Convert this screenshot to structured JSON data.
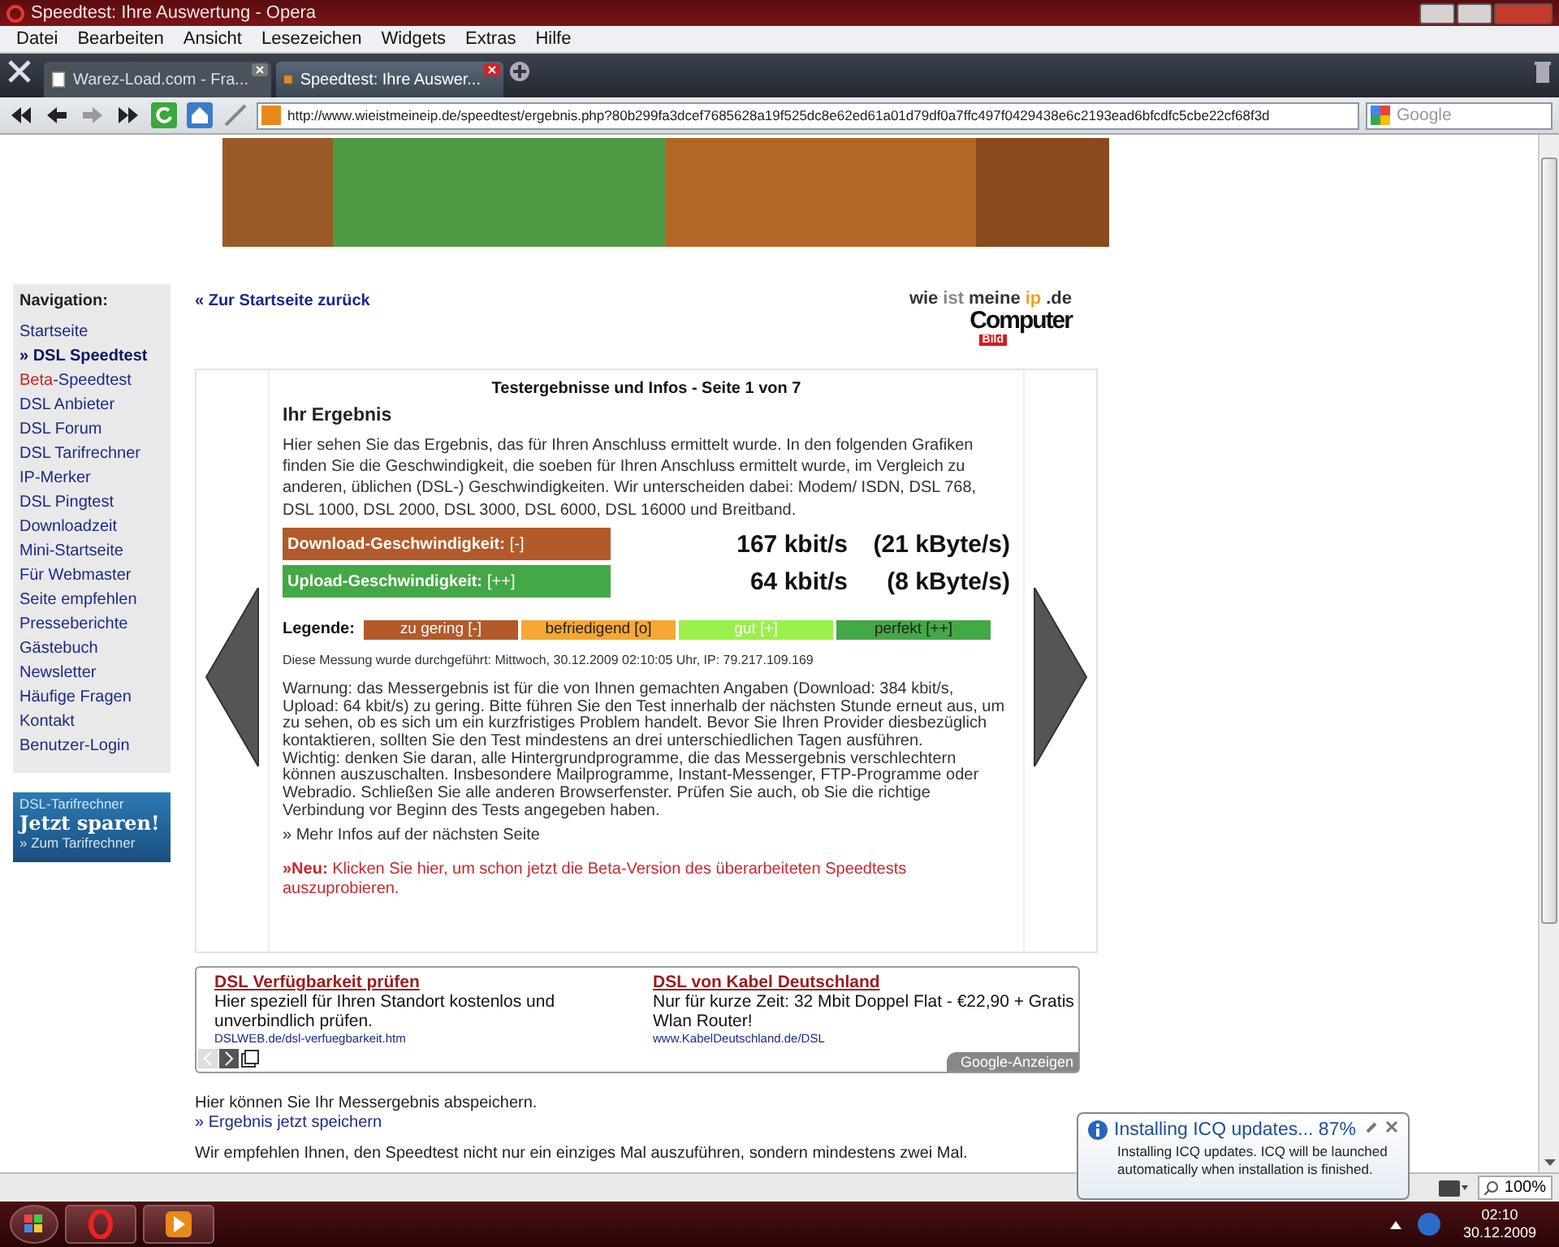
{
  "window": {
    "title": "Speedtest: Ihre Auswertung - Opera"
  },
  "menu": [
    "Datei",
    "Bearbeiten",
    "Ansicht",
    "Lesezeichen",
    "Widgets",
    "Extras",
    "Hilfe"
  ],
  "tabs": [
    {
      "label": "Warez-Load.com - Fra...",
      "selected": false
    },
    {
      "label": "Speedtest: Ihre Auswer...",
      "selected": true
    }
  ],
  "address_bar": {
    "url": "http://www.wieistmeineip.de/speedtest/ergebnis.php?80b299fa3dcef7685628a19f525dc8e62ed61a01d79df0a7ffc497f0429438e6c2193ead6bfcdfc5cbe22cf68f3d",
    "search_placeholder": "Google"
  },
  "sidebar": {
    "title": "Navigation:",
    "items": [
      {
        "label": "Startseite",
        "selected": false
      },
      {
        "label": "» DSL Speedtest",
        "selected": true
      },
      {
        "prefix": "Beta",
        "label": "-Speedtest",
        "selected": false
      },
      {
        "label": "DSL Anbieter",
        "selected": false
      },
      {
        "label": "DSL Forum",
        "selected": false
      },
      {
        "label": "DSL Tarifrechner",
        "selected": false
      },
      {
        "label": "IP-Merker",
        "selected": false
      },
      {
        "label": "DSL Pingtest",
        "selected": false
      },
      {
        "label": "Downloadzeit",
        "selected": false
      },
      {
        "label": "Mini-Startseite",
        "selected": false
      },
      {
        "label": "Für Webmaster",
        "selected": false
      },
      {
        "label": "Seite empfehlen",
        "selected": false
      },
      {
        "label": "Presseberichte",
        "selected": false
      },
      {
        "label": "Gästebuch",
        "selected": false
      },
      {
        "label": "Newsletter",
        "selected": false
      },
      {
        "label": "Häufige Fragen",
        "selected": false
      },
      {
        "label": "Kontakt",
        "selected": false
      },
      {
        "label": "Benutzer-Login",
        "selected": false
      }
    ],
    "promo": {
      "title": "DSL-Tarifrechner",
      "headline": "Jetzt sparen!",
      "link": "» Zum Tarifrechner"
    }
  },
  "back_link": "« Zur Startseite zurück",
  "logo": {
    "words": [
      {
        "text": "wie",
        "color": "#333333"
      },
      {
        "text": "ist",
        "color": "#888888"
      },
      {
        "text": "meine",
        "color": "#333333"
      },
      {
        "text": "ip",
        "color": "#f0a020"
      },
      {
        "text": ".de",
        "color": "#333333"
      }
    ],
    "brand": "Computer",
    "badge": "Bild"
  },
  "results": {
    "title": "Testergebnisse und Infos - Seite 1 von 7",
    "heading": "Ihr Ergebnis",
    "intro": "Hier sehen Sie das Ergebnis, das für Ihren Anschluss ermittelt wurde. In den folgenden Grafiken finden Sie die Geschwindigkeit, die soeben für Ihren Anschluss ermittelt wurde, im Vergleich zu anderen, üblichen (DSL-) Geschwindigkeiten. Wir unterscheiden dabei: Modem/ ISDN, DSL 768, DSL 1000, DSL 2000, DSL 3000, DSL 6000, DSL 16000 und Breitband.",
    "speeds": [
      {
        "label": "Download-Geschwindigkeit:",
        "rating": "[-]",
        "color": "#b25a2a",
        "kbit": "167 kbit/s",
        "kbyte": "(21 kByte/s)"
      },
      {
        "label": "Upload-Geschwindigkeit:",
        "rating": "[++]",
        "color": "#43a845",
        "kbit": "64 kbit/s",
        "kbyte": "(8 kByte/s)"
      }
    ],
    "legend": {
      "label": "Legende:",
      "items": [
        {
          "label": "zu gering [-]",
          "color": "#b25a2a"
        },
        {
          "label": "befriedigend [o]",
          "color": "#f5a833"
        },
        {
          "label": "gut [+]",
          "color": "#9af04a"
        },
        {
          "label": "perfekt [++]",
          "color": "#43a845"
        }
      ]
    },
    "measured": "Diese Messung wurde durchgeführt: Mittwoch, 30.12.2009 02:10:05 Uhr, IP: 79.217.109.169",
    "warnings": [
      "Warnung: das Messergebnis ist für die von Ihnen gemachten Angaben (Download: 384 kbit/s, Upload: 64 kbit/s) zu gering. Bitte führen Sie den Test innerhalb der nächsten Stunde erneut aus, um zu sehen, ob es sich um ein kurzfristiges Problem handelt. Bevor Sie Ihren Provider diesbezüglich kontaktieren, sollten Sie den Test mindestens an drei unterschiedlichen Tagen ausführen.",
      "Wichtig: denken Sie daran, alle Hintergrundprogramme, die das Messergebnis verschlechtern können auszuschalten. Insbesondere Mailprogramme, Instant-Messenger, FTP-Programme oder Webradio. Schließen Sie alle anderen Browserfenster. Prüfen Sie auch, ob Sie die richtige Verbindung vor Beginn des Tests angegeben haben."
    ],
    "more_link": "» Mehr Infos auf der nächsten Seite",
    "beta_notice": "**»Neu:** Klicken Sie hier, um schon jetzt die Beta-Version des überarbeiteten Speedtests auszuprobieren."
  },
  "ads": {
    "items": [
      {
        "title": "DSL Verfügbarkeit prüfen",
        "text": "Hier speziell für Ihren Standort kostenlos und unverbindlich prüfen.",
        "url": "DSLWEB.de/dsl-verfuegbarkeit.htm"
      },
      {
        "title": "DSL von Kabel Deutschland",
        "text": "Nur für kurze Zeit: 32 Mbit Doppel Flat - €22,90 + Gratis Wlan Router!",
        "url": "www.KabelDeutschland.de/DSL"
      }
    ],
    "label": "Google-Anzeigen"
  },
  "save_text": "Hier können Sie Ihr Messergebnis abspeichern.",
  "save_link": "» Ergebnis jetzt speichern",
  "recommend": "Wir empfehlen Ihnen, den Speedtest nicht nur ein einziges Mal auszuführen, sondern mindestens zwei Mal.",
  "status_bar": {
    "zoom": "100%"
  },
  "notification": {
    "title": "Installing ICQ updates... 87%",
    "text": "Installing ICQ updates. ICQ will be launched automatically when installation is finished."
  },
  "taskbar": {
    "time": "02:10",
    "date": "30.12.2009"
  }
}
